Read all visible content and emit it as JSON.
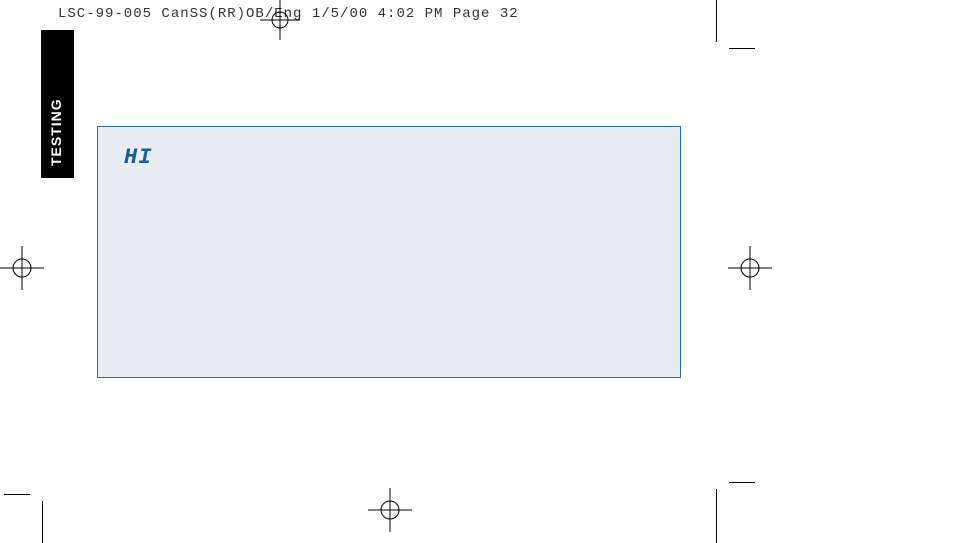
{
  "header": {
    "slug": "LSC-99-005 CanSS(RR)OB/Eng  1/5/00 4:02 PM  Page 32"
  },
  "sidebar": {
    "tab_label": "TESTING"
  },
  "box": {
    "text": "HI"
  }
}
